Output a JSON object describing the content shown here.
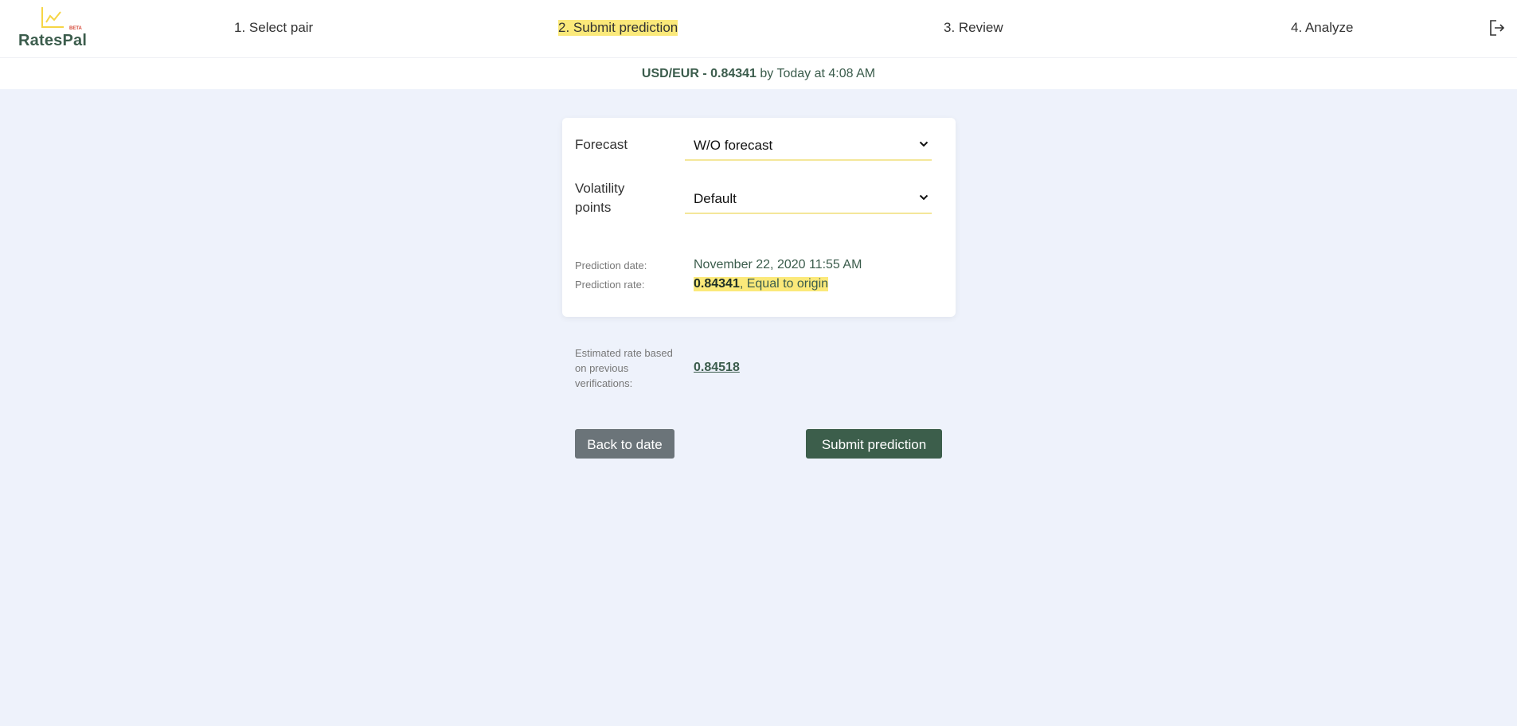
{
  "app": {
    "logo_text": "RatesPal",
    "logo_badge": "BETA"
  },
  "steps": [
    {
      "label": "1. Select pair",
      "active": false
    },
    {
      "label": "2. Submit prediction",
      "active": true
    },
    {
      "label": "3. Review",
      "active": false
    },
    {
      "label": "4. Analyze",
      "active": false
    }
  ],
  "rate_bar": {
    "pair_rate": "USD/EUR - 0.84341",
    "suffix": " by Today at 4:08 AM"
  },
  "form": {
    "forecast_label": "Forecast",
    "forecast_value": "W/O forecast",
    "volatility_label_line1": "Volatility",
    "volatility_label_line2": "points",
    "volatility_value": "Default",
    "prediction_date_label": "Prediction date:",
    "prediction_date_value": "November 22, 2020 11:55 AM",
    "prediction_rate_label": "Prediction rate:",
    "prediction_rate_value": "0.84341",
    "prediction_rate_note": ", Equal to origin"
  },
  "estimate": {
    "label": "Estimated rate based on previous verifications:",
    "value": "0.84518"
  },
  "buttons": {
    "back": "Back to date",
    "submit": "Submit prediction"
  },
  "icons": {
    "logo": "chart-line-icon",
    "logout": "logout-icon",
    "dropdown": "chevron-down-icon"
  },
  "colors": {
    "highlight": "#fbe97a",
    "primary": "#3c5e4b",
    "secondary": "#6b7479",
    "background": "#eef2fb"
  }
}
